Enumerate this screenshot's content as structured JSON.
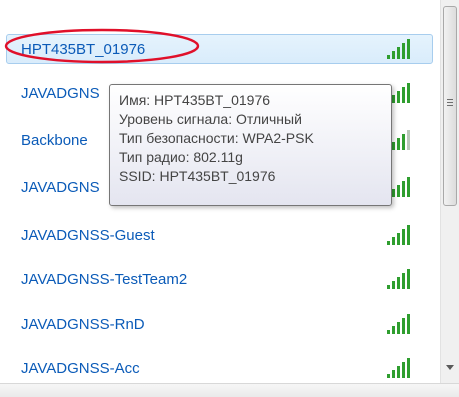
{
  "networks": [
    {
      "name": "HPT435BT_01976",
      "selected": true
    },
    {
      "name": "JAVADGNS",
      "selected": false
    },
    {
      "name": "Backbone",
      "selected": false
    },
    {
      "name": "JAVADGNS",
      "selected": false
    },
    {
      "name": "JAVADGNSS-Guest",
      "selected": false
    },
    {
      "name": "JAVADGNSS-TestTeam2",
      "selected": false
    },
    {
      "name": "JAVADGNSS-RnD",
      "selected": false
    },
    {
      "name": "JAVADGNSS-Acc",
      "selected": false
    }
  ],
  "tooltip": {
    "name_line": "Имя: HPT435BT_01976",
    "signal_line": "Уровень сигнала: Отличный",
    "security_line": "Тип безопасности: WPA2-PSK",
    "radio_line": "Тип радио: 802.11g",
    "ssid_line": "SSID: HPT435BT_01976"
  },
  "colors": {
    "network_text": "#0b5bb8",
    "signal_bars": "#2f9e2f",
    "highlight_ellipse": "#e0102a",
    "selected_row": "#dbecfb"
  },
  "icons": {
    "signal": "wifi-signal-icon",
    "scroll_grip": "scroll-grip-icon",
    "scroll_down": "scroll-down-arrow-icon"
  }
}
